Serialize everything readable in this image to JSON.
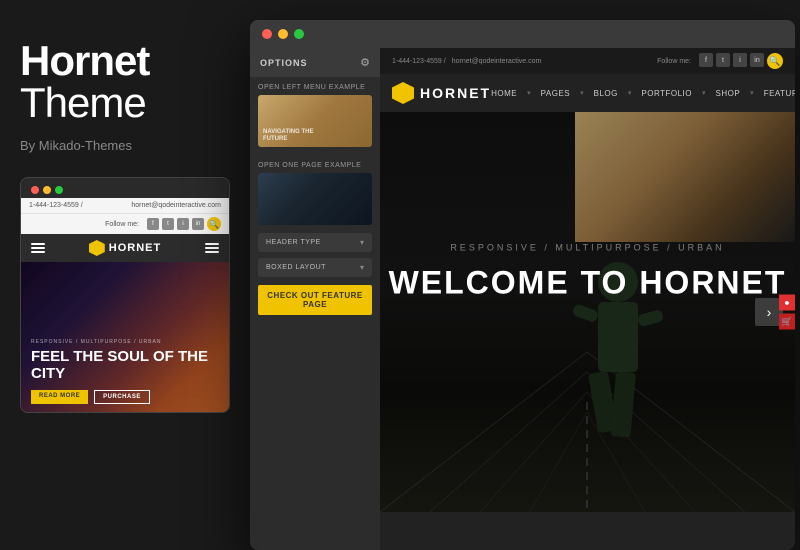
{
  "leftPanel": {
    "title_bold": "Hornet",
    "title_light": "Theme",
    "author": "By Mikado-Themes"
  },
  "mobilePreview": {
    "dots": [
      "red",
      "yellow",
      "green"
    ],
    "infoBar": {
      "phone": "1-444-123-4559 /",
      "email": "hornet@qodeinteractive.com"
    },
    "followLabel": "Follow me:",
    "navLogo": "HORNET",
    "heroTagline": "RESPONSIVE / MULTIPURPOSE / URBAN",
    "heroTitle": "FEEL THE SOUL OF THE CITY",
    "btn1": "READ MORE",
    "btn2": "PURCHASE"
  },
  "browser": {
    "dots": [
      "red",
      "yellow",
      "green"
    ]
  },
  "optionsPanel": {
    "header": "OPTIONS",
    "gearSymbol": "⚙",
    "section1Label": "OPEN LEFT MENU EXAMPLE",
    "section2Label": "OPEN ONE PAGE EXAMPLE",
    "headerTypeLabel": "HEADER TYPE",
    "boxedLayoutLabel": "BOXED LAYOUT",
    "checkoutBtnLabel": "CHECK OUT FEATURE PAGE"
  },
  "sitePreview": {
    "topBar": {
      "phone": "1-444-123-4559 /",
      "email": "hornet@qodeinteractive.com",
      "followLabel": "Follow me:"
    },
    "nav": {
      "logoText": "HORNET",
      "links": [
        "HOME",
        "PAGES",
        "BLOG",
        "PORTFOLIO",
        "SHOP",
        "FEATURES"
      ]
    },
    "hero": {
      "tagline": "RESPONSIVE / MULTIPURPOSE / URBAN",
      "title": "WELCOME TO HORNET",
      "arrowRight": "›"
    }
  },
  "icons": {
    "search": "🔍",
    "cart": "🛒",
    "dots": "•••",
    "chevronDown": "▾",
    "chevronRight": "›",
    "hamburger": "≡",
    "gear": "⚙",
    "facebook": "f",
    "twitter": "t",
    "instagram": "i",
    "linkedin": "in"
  }
}
